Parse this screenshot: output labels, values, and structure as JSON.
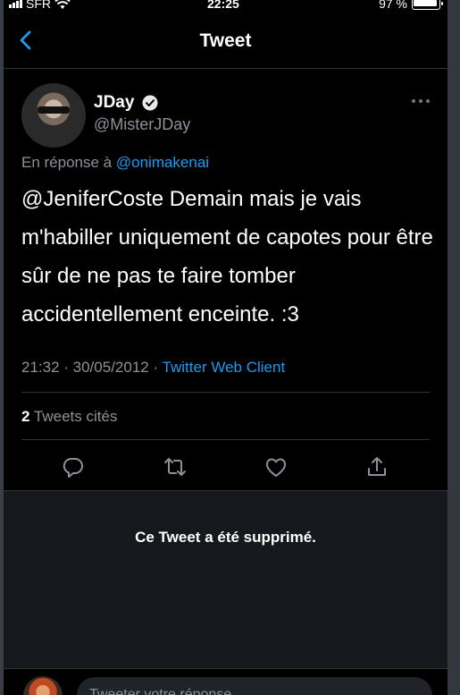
{
  "status_bar": {
    "carrier": "SFR",
    "time": "22:25",
    "battery": "97 %"
  },
  "header": {
    "title": "Tweet"
  },
  "tweet": {
    "author_name": "JDay",
    "author_handle": "@MisterJDay",
    "reply_prefix": "En réponse à",
    "reply_mention": "@onimakenai",
    "text": "@JeniferCoste Demain mais je vais m'habiller uniquement de capotes pour être sûr de ne pas te faire tomber accidentellement enceinte. :3",
    "timestamp": "21:32 · 30/05/2012 · ",
    "client": "Twitter Web Client",
    "quote_count": "2",
    "quote_label": "Tweets cités"
  },
  "deleted_notice": "Ce Tweet a été supprimé.",
  "compose": {
    "placeholder": "Tweeter votre réponse"
  },
  "colors": {
    "accent": "#1d9bf0",
    "background": "#000000",
    "secondary_text": "#8b9299"
  },
  "icons": [
    "back-chevron-icon",
    "verified-badge-icon",
    "more-options-icon",
    "reply-icon",
    "retweet-icon",
    "like-icon",
    "share-icon"
  ]
}
